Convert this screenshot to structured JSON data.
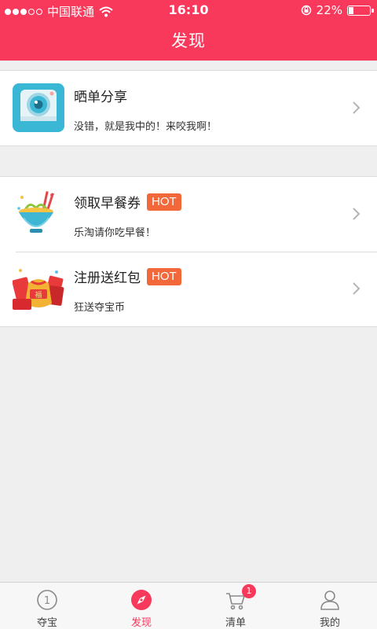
{
  "status_bar": {
    "carrier": "中国联通",
    "time": "16:10",
    "battery": "22%"
  },
  "header": {
    "title": "发现"
  },
  "items": [
    {
      "title": "晒单分享",
      "subtitle": "没错，就是我中的！来咬我啊！",
      "hot": "",
      "icon": "camera-icon"
    },
    {
      "title": "领取早餐券",
      "subtitle": "乐淘请你吃早餐！",
      "hot": "HOT",
      "icon": "noodle-bowl-icon"
    },
    {
      "title": "注册送红包",
      "subtitle": "狂送夺宝币",
      "hot": "HOT",
      "icon": "red-envelope-icon"
    }
  ],
  "tabbar": {
    "tabs": [
      {
        "label": "夺宝",
        "icon": "coin-icon"
      },
      {
        "label": "发现",
        "icon": "compass-icon"
      },
      {
        "label": "清单",
        "icon": "cart-icon",
        "badge": "1"
      },
      {
        "label": "我的",
        "icon": "user-icon"
      }
    ],
    "active_index": 1
  },
  "colors": {
    "brand": "#f8395c",
    "hot": "#f2683a",
    "background": "#efefef"
  }
}
